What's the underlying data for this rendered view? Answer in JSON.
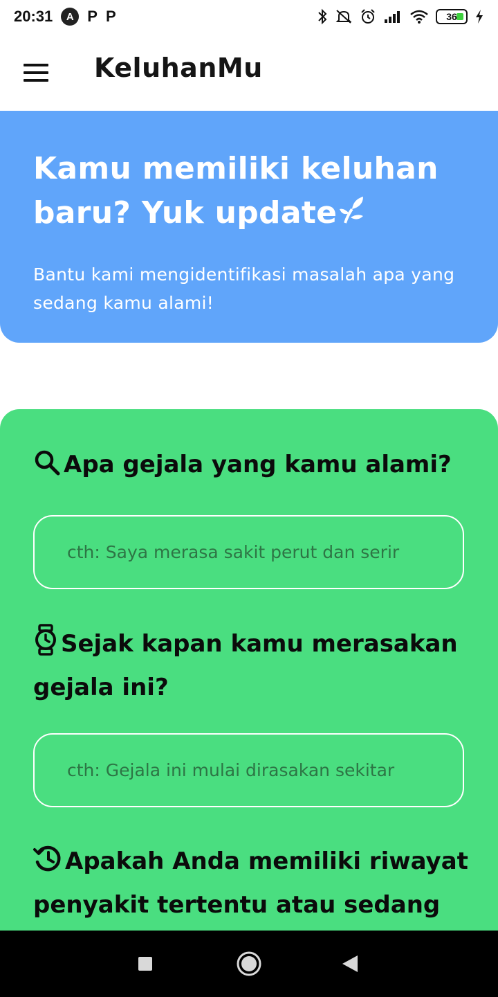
{
  "status_bar": {
    "time": "20:31",
    "left_icons": [
      "a-circle-icon",
      "p-icon",
      "p-icon"
    ],
    "p_letter": "P",
    "a_letter": "A",
    "right_icons": [
      "bluetooth-icon",
      "mute-icon",
      "alarm-icon",
      "signal-icon",
      "wifi-icon",
      "battery-icon",
      "charging-icon"
    ],
    "battery_level": "36"
  },
  "app_bar": {
    "title": "KeluhanMu",
    "menu_icon": "hamburger-menu-icon"
  },
  "hero": {
    "title": "Kamu memiliki keluhan baru? Yuk update",
    "title_icon": "sprout-icon",
    "subtitle": "Bantu kami mengidentifikasi masalah apa yang sedang kamu alami!",
    "background": "#60a5fa"
  },
  "form": {
    "background": "#4ade80",
    "questions": [
      {
        "icon": "search-icon",
        "label": "Apa gejala yang kamu alami?",
        "placeholder": "cth: Saya merasa sakit perut dan serir"
      },
      {
        "icon": "watch-icon",
        "label": "Sejak kapan kamu merasakan gejala ini?",
        "placeholder": "cth: Gejala ini mulai dirasakan sekitar"
      },
      {
        "icon": "history-icon",
        "label": "Apakah Anda memiliki riwayat penyakit tertentu atau sedang"
      }
    ]
  },
  "nav_bar": {
    "icons": [
      "recent-apps-icon",
      "home-icon",
      "back-icon"
    ]
  }
}
